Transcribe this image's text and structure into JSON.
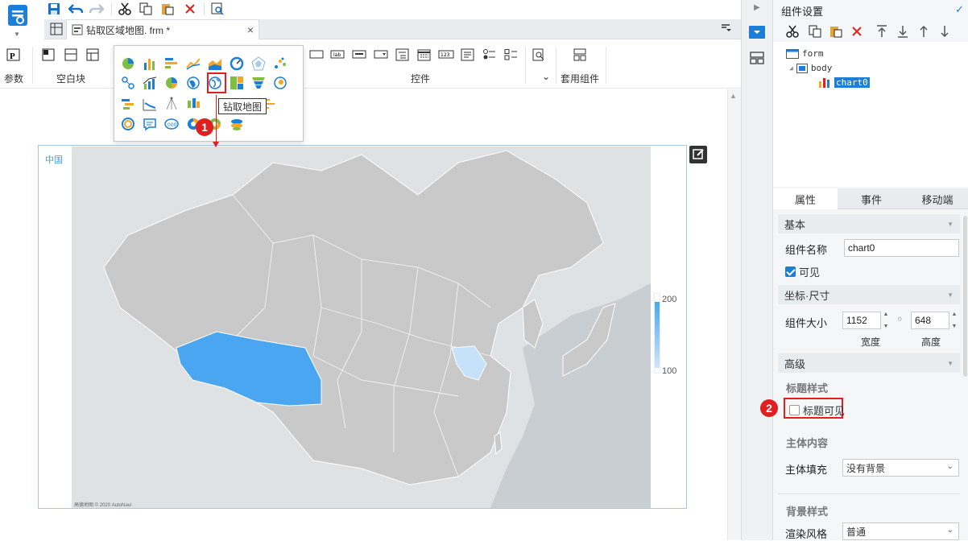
{
  "topbar": {
    "icons": [
      "app-logo-icon",
      "save-icon",
      "undo-icon",
      "redo-icon",
      "cut-icon",
      "copy-icon",
      "paste-icon",
      "delete-icon",
      "preview-icon"
    ]
  },
  "tab": {
    "file_name": "钻取区域地图. frm *",
    "close": "×"
  },
  "ribbon": {
    "param_label": "参数",
    "blank_label": "空白块",
    "controls_label": "控件",
    "preset_label": "套用组件",
    "controls_caret": "⌄"
  },
  "popup": {
    "tooltip": "钻取地图",
    "marker_1": "1",
    "marker_2": "2"
  },
  "chart": {
    "title": "中国",
    "legend_max": "200",
    "legend_min": "100",
    "attribution": "高德地图 © 2020 AutoNavi"
  },
  "right_panel": {
    "title": "组件设置",
    "tree": {
      "root": "form",
      "body": "body",
      "chart": "chart0"
    },
    "tabs": [
      "属性",
      "事件",
      "移动端"
    ],
    "basic": {
      "section": "基本",
      "name_label": "组件名称",
      "name_value": "chart0",
      "visible_label": "可见"
    },
    "coords": {
      "section": "坐标·尺寸",
      "size_label": "组件大小",
      "width_value": "1152",
      "height_value": "648",
      "width_label": "宽度",
      "height_label": "高度"
    },
    "advanced": {
      "section": "高级",
      "title_style": "标题样式",
      "title_visible": "标题可见",
      "body_content": "主体内容",
      "body_fill_label": "主体填充",
      "body_fill_value": "没有背景",
      "bg_style": "背景样式",
      "render_label": "渲染风格",
      "render_value": "普通"
    }
  },
  "colors": {
    "accent": "#1b7ed8",
    "highlight": "#e02020",
    "map_high": "#4aa6f0",
    "map_low": "#c6e2fa"
  }
}
